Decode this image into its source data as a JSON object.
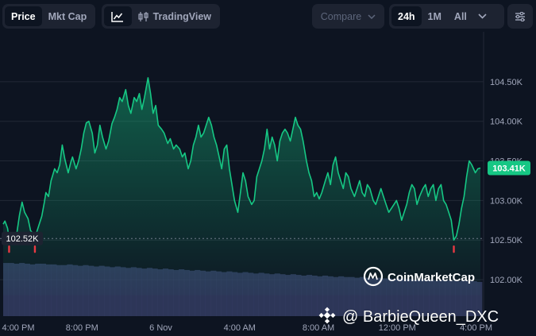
{
  "toolbar": {
    "metric_tabs": [
      "Price",
      "Mkt Cap"
    ],
    "active_metric": "Price",
    "chart_tools": {
      "line_icon": "line-chart-icon",
      "tradingview_icon": "candlestick-icon",
      "tradingview_label": "TradingView"
    },
    "compare_label": "Compare",
    "ranges": [
      "24h",
      "1M",
      "All"
    ],
    "active_range": "24h",
    "settings_icon": "sliders-icon"
  },
  "watermarks": {
    "brand": "CoinMarketCap",
    "user": "@ BarbieQueen_DXC"
  },
  "colors": {
    "background": "#0d1421",
    "line": "#16c784",
    "low_marker": "#ea3943",
    "current_badge": "#16c784",
    "volume": "#3a4270"
  },
  "chart_data": {
    "type": "area",
    "title": "",
    "xlabel": "",
    "ylabel": "",
    "ylim": [
      101800,
      104980
    ],
    "yticks": [
      102000,
      102500,
      103000,
      103500,
      104000,
      104500
    ],
    "ytick_labels": [
      "102.00K",
      "102.50K",
      "103.00K",
      "103.50K",
      "104.00K",
      "104.50K"
    ],
    "xlim": [
      0,
      24.3
    ],
    "xticks": [
      0,
      4,
      8,
      12,
      16,
      20,
      24
    ],
    "xtick_labels": [
      "4:00 PM",
      "8:00 PM",
      "6 Nov",
      "4:00 AM",
      "8:00 AM",
      "12:00 PM",
      "4:00 PM"
    ],
    "open_price_label": "102.52K",
    "open_price": 102520,
    "current_price_label": "103.41K",
    "current_price": 103410,
    "series": [
      {
        "values": [
          [
            0.0,
            102700
          ],
          [
            0.09,
            102740
          ],
          [
            0.22,
            102650
          ],
          [
            0.3,
            102520
          ],
          [
            0.39,
            102560
          ],
          [
            0.57,
            102540
          ],
          [
            0.7,
            102600
          ],
          [
            0.83,
            102820
          ],
          [
            0.96,
            102980
          ],
          [
            1.09,
            102850
          ],
          [
            1.26,
            102770
          ],
          [
            1.39,
            102620
          ],
          [
            1.52,
            102580
          ],
          [
            1.61,
            102510
          ],
          [
            1.7,
            102600
          ],
          [
            1.83,
            102700
          ],
          [
            1.96,
            102800
          ],
          [
            2.09,
            102980
          ],
          [
            2.17,
            103100
          ],
          [
            2.3,
            103050
          ],
          [
            2.43,
            103250
          ],
          [
            2.61,
            103400
          ],
          [
            2.74,
            103350
          ],
          [
            2.87,
            103450
          ],
          [
            3.0,
            103700
          ],
          [
            3.13,
            103520
          ],
          [
            3.3,
            103350
          ],
          [
            3.43,
            103480
          ],
          [
            3.52,
            103550
          ],
          [
            3.7,
            103400
          ],
          [
            3.83,
            103500
          ],
          [
            3.96,
            103650
          ],
          [
            4.09,
            103850
          ],
          [
            4.22,
            103980
          ],
          [
            4.35,
            104000
          ],
          [
            4.52,
            103850
          ],
          [
            4.65,
            103600
          ],
          [
            4.78,
            103700
          ],
          [
            4.91,
            103950
          ],
          [
            5.04,
            103800
          ],
          [
            5.22,
            103650
          ],
          [
            5.35,
            103750
          ],
          [
            5.52,
            103970
          ],
          [
            5.65,
            104050
          ],
          [
            5.78,
            104150
          ],
          [
            5.91,
            104300
          ],
          [
            6.04,
            104250
          ],
          [
            6.22,
            104400
          ],
          [
            6.35,
            104200
          ],
          [
            6.48,
            104100
          ],
          [
            6.65,
            104300
          ],
          [
            6.78,
            104250
          ],
          [
            6.91,
            104350
          ],
          [
            7.04,
            104150
          ],
          [
            7.17,
            104300
          ],
          [
            7.35,
            104550
          ],
          [
            7.48,
            104350
          ],
          [
            7.61,
            104100
          ],
          [
            7.74,
            104200
          ],
          [
            7.87,
            103950
          ],
          [
            8.04,
            103900
          ],
          [
            8.17,
            103850
          ],
          [
            8.35,
            103720
          ],
          [
            8.48,
            103780
          ],
          [
            8.65,
            103650
          ],
          [
            8.78,
            103700
          ],
          [
            8.96,
            103650
          ],
          [
            9.09,
            103550
          ],
          [
            9.22,
            103600
          ],
          [
            9.39,
            103400
          ],
          [
            9.52,
            103500
          ],
          [
            9.65,
            103700
          ],
          [
            9.78,
            103800
          ],
          [
            9.91,
            103950
          ],
          [
            10.04,
            103800
          ],
          [
            10.17,
            103850
          ],
          [
            10.3,
            103950
          ],
          [
            10.43,
            104050
          ],
          [
            10.57,
            103950
          ],
          [
            10.7,
            103800
          ],
          [
            10.83,
            103700
          ],
          [
            10.96,
            103550
          ],
          [
            11.09,
            103400
          ],
          [
            11.22,
            103650
          ],
          [
            11.35,
            103700
          ],
          [
            11.48,
            103400
          ],
          [
            11.61,
            103200
          ],
          [
            11.74,
            103000
          ],
          [
            11.91,
            102850
          ],
          [
            12.04,
            103100
          ],
          [
            12.17,
            103350
          ],
          [
            12.3,
            103250
          ],
          [
            12.43,
            103050
          ],
          [
            12.61,
            102950
          ],
          [
            12.74,
            103000
          ],
          [
            12.87,
            103300
          ],
          [
            13.0,
            103400
          ],
          [
            13.13,
            103500
          ],
          [
            13.26,
            103650
          ],
          [
            13.39,
            103900
          ],
          [
            13.52,
            103650
          ],
          [
            13.65,
            103800
          ],
          [
            13.78,
            103700
          ],
          [
            13.91,
            103500
          ],
          [
            14.04,
            103750
          ],
          [
            14.17,
            103850
          ],
          [
            14.3,
            103900
          ],
          [
            14.43,
            103850
          ],
          [
            14.57,
            103750
          ],
          [
            14.7,
            103900
          ],
          [
            14.83,
            104050
          ],
          [
            14.96,
            103950
          ],
          [
            15.09,
            103900
          ],
          [
            15.22,
            103750
          ],
          [
            15.39,
            103500
          ],
          [
            15.52,
            103350
          ],
          [
            15.65,
            103250
          ],
          [
            15.78,
            103050
          ],
          [
            15.91,
            103100
          ],
          [
            16.04,
            103020
          ],
          [
            16.17,
            103100
          ],
          [
            16.35,
            103250
          ],
          [
            16.48,
            103350
          ],
          [
            16.61,
            103200
          ],
          [
            16.74,
            103450
          ],
          [
            16.87,
            103550
          ],
          [
            17.0,
            103350
          ],
          [
            17.13,
            103250
          ],
          [
            17.26,
            103150
          ],
          [
            17.39,
            103350
          ],
          [
            17.52,
            103300
          ],
          [
            17.65,
            103150
          ],
          [
            17.83,
            103050
          ],
          [
            17.96,
            103150
          ],
          [
            18.09,
            103250
          ],
          [
            18.22,
            103100
          ],
          [
            18.35,
            103050
          ],
          [
            18.48,
            103200
          ],
          [
            18.61,
            103150
          ],
          [
            18.78,
            103000
          ],
          [
            18.91,
            102950
          ],
          [
            19.04,
            103050
          ],
          [
            19.17,
            103150
          ],
          [
            19.3,
            103050
          ],
          [
            19.43,
            102950
          ],
          [
            19.57,
            102850
          ],
          [
            19.7,
            102900
          ],
          [
            19.83,
            102950
          ],
          [
            19.96,
            103000
          ],
          [
            20.09,
            102900
          ],
          [
            20.22,
            102750
          ],
          [
            20.35,
            102850
          ],
          [
            20.48,
            102950
          ],
          [
            20.61,
            103100
          ],
          [
            20.74,
            103200
          ],
          [
            20.87,
            103150
          ],
          [
            21.0,
            102950
          ],
          [
            21.13,
            103050
          ],
          [
            21.3,
            103150
          ],
          [
            21.43,
            103200
          ],
          [
            21.57,
            103050
          ],
          [
            21.7,
            103150
          ],
          [
            21.83,
            103200
          ],
          [
            21.96,
            103000
          ],
          [
            22.09,
            103150
          ],
          [
            22.22,
            103200
          ],
          [
            22.35,
            103000
          ],
          [
            22.48,
            102950
          ],
          [
            22.61,
            102850
          ],
          [
            22.74,
            102750
          ],
          [
            22.87,
            102500
          ],
          [
            23.0,
            102550
          ],
          [
            23.13,
            102700
          ],
          [
            23.26,
            102900
          ],
          [
            23.39,
            103050
          ],
          [
            23.52,
            103300
          ],
          [
            23.65,
            103500
          ],
          [
            23.78,
            103450
          ],
          [
            23.96,
            103350
          ],
          [
            24.09,
            103400
          ],
          [
            24.22,
            103410
          ]
        ]
      }
    ],
    "low_markers_x": [
      0.3,
      1.61,
      22.87
    ],
    "volume": [
      0.6,
      0.6,
      0.59,
      0.6,
      0.59,
      0.58,
      0.59,
      0.59,
      0.58,
      0.58,
      0.57,
      0.57,
      0.58,
      0.57,
      0.56,
      0.57,
      0.56,
      0.55,
      0.56,
      0.55,
      0.54,
      0.55,
      0.54,
      0.53,
      0.54,
      0.53,
      0.52,
      0.53,
      0.52,
      0.51,
      0.52,
      0.51,
      0.5,
      0.51,
      0.5,
      0.49,
      0.5,
      0.49,
      0.48,
      0.49,
      0.48,
      0.47,
      0.48,
      0.47,
      0.46,
      0.47,
      0.46,
      0.45,
      0.46,
      0.45,
      0.44,
      0.45,
      0.44,
      0.43,
      0.44,
      0.43,
      0.42,
      0.43,
      0.42,
      0.41,
      0.42,
      0.41,
      0.4,
      0.41,
      0.4,
      0.4,
      0.39,
      0.4,
      0.39,
      0.38,
      0.39,
      0.38,
      0.38,
      0.37,
      0.38,
      0.37,
      0.37,
      0.36,
      0.37,
      0.36,
      0.36,
      0.35,
      0.36,
      0.35,
      0.35,
      0.34,
      0.35,
      0.34,
      0.34,
      0.33
    ],
    "grid": "horizontal",
    "legend": "none"
  }
}
